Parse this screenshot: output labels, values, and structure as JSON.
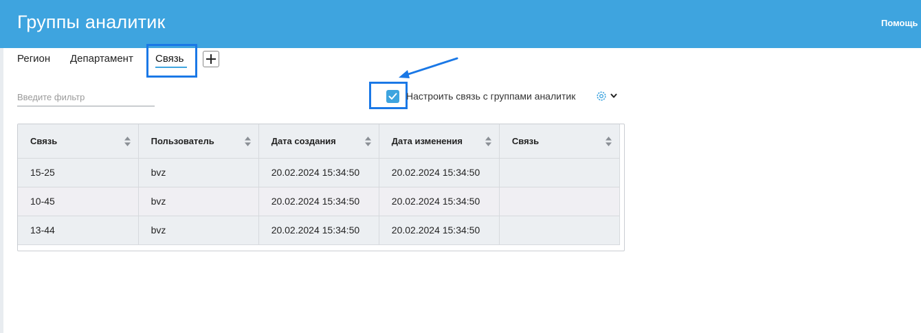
{
  "header": {
    "title": "Группы аналитик",
    "help_label": "Помощь"
  },
  "tabs": [
    {
      "label": "Регион",
      "active": false
    },
    {
      "label": "Департамент",
      "active": false
    },
    {
      "label": "Связь",
      "active": true
    }
  ],
  "filter": {
    "placeholder": "Введите фильтр",
    "value": ""
  },
  "link_setting": {
    "checked": true,
    "label": "Настроить связь с группами аналитик"
  },
  "icons": {
    "add_tab": "plus-icon",
    "settings": "gear-icon",
    "dropdown": "chevron-down-icon",
    "sort": "sort-icon",
    "checkmark": "check-icon"
  },
  "colors": {
    "header_bg": "#3ea4df",
    "accent": "#3ea4df",
    "annotation": "#1a78e6"
  },
  "table": {
    "columns": [
      "Связь",
      "Пользователь",
      "Дата создания",
      "Дата изменения",
      "Связь"
    ],
    "rows": [
      [
        "15-25",
        "bvz",
        "20.02.2024 15:34:50",
        "20.02.2024 15:34:50",
        ""
      ],
      [
        "10-45",
        "bvz",
        "20.02.2024 15:34:50",
        "20.02.2024 15:34:50",
        ""
      ],
      [
        "13-44",
        "bvz",
        "20.02.2024 15:34:50",
        "20.02.2024 15:34:50",
        ""
      ]
    ]
  }
}
